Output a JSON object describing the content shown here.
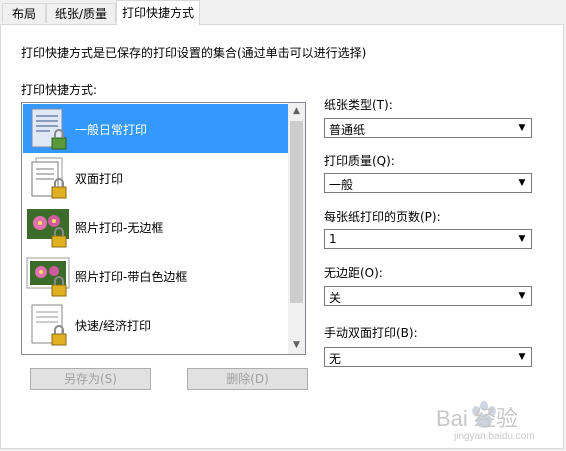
{
  "tabs": [
    {
      "label": "布局"
    },
    {
      "label": "纸张/质量"
    },
    {
      "label": "打印快捷方式"
    }
  ],
  "description": "打印快捷方式是已保存的打印设置的集合(通过单击可以进行选择)",
  "shortcuts": {
    "label": "打印快捷方式:",
    "items": [
      {
        "name": "一般日常打印",
        "icon": "document-lock-icon",
        "selected": true
      },
      {
        "name": "双面打印",
        "icon": "duplex-document-lock-icon",
        "selected": false
      },
      {
        "name": "照片打印-无边框",
        "icon": "photo-flower-lock-icon",
        "selected": false
      },
      {
        "name": "照片打印-带白色边框",
        "icon": "photo-flower-border-lock-icon",
        "selected": false
      },
      {
        "name": "快速/经济打印",
        "icon": "document-lock-icon",
        "selected": false
      }
    ]
  },
  "buttons": {
    "save_as": "另存为(S)",
    "delete": "删除(D)"
  },
  "settings": {
    "paper_type": {
      "label": "纸张类型(T):",
      "value": "普通纸"
    },
    "print_quality": {
      "label": "打印质量(Q):",
      "value": "一般"
    },
    "pages_per_sheet": {
      "label": "每张纸打印的页数(P):",
      "value": "1"
    },
    "borderless": {
      "label": "无边距(O):",
      "value": "关"
    },
    "manual_duplex": {
      "label": "手动双面打印(B):",
      "value": "无"
    }
  },
  "watermark": {
    "text": "Bai 经验",
    "subtext": "jingyan.baidu.com"
  },
  "colors": {
    "selection": "#3399ff",
    "panel": "#ffffff",
    "window": "#f0f0f0"
  }
}
